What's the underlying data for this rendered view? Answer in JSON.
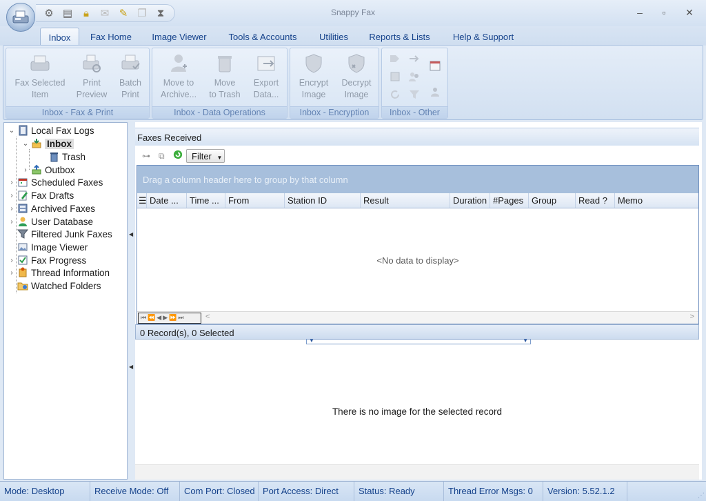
{
  "window": {
    "title": "Snappy Fax",
    "minimize": "–",
    "maximize": "▫",
    "close": "✕"
  },
  "quick_access_icons": [
    "gear-icon",
    "document-icon",
    "lock-icon",
    "fax-icon",
    "wand-icon",
    "copy-icon",
    "hourglass-icon"
  ],
  "tabs": [
    {
      "label": "Inbox",
      "active": true
    },
    {
      "label": "Fax Home"
    },
    {
      "label": "Image Viewer"
    },
    {
      "label": "Tools & Accounts"
    },
    {
      "label": "Utilities"
    },
    {
      "label": "Reports & Lists"
    },
    {
      "label": "Help & Support"
    }
  ],
  "ribbon": {
    "groups": [
      {
        "label": "Inbox - Fax & Print",
        "buttons": [
          {
            "line1": "Fax Selected",
            "line2": "Item"
          },
          {
            "line1": "Print",
            "line2": "Preview"
          },
          {
            "line1": "Batch",
            "line2": "Print"
          }
        ]
      },
      {
        "label": "Inbox - Data Operations",
        "buttons": [
          {
            "line1": "Move to",
            "line2": "Archive..."
          },
          {
            "line1": "Move",
            "line2": "to Trash"
          },
          {
            "line1": "Export",
            "line2": "Data..."
          }
        ]
      },
      {
        "label": "Inbox - Encryption",
        "buttons": [
          {
            "line1": "Encrypt",
            "line2": "Image"
          },
          {
            "line1": "Decrypt",
            "line2": "Image"
          }
        ]
      },
      {
        "label": "Inbox - Other"
      }
    ]
  },
  "tree": {
    "items": [
      {
        "label": "Local Fax Logs"
      },
      {
        "label": "Inbox",
        "selected": true
      },
      {
        "label": "Trash"
      },
      {
        "label": "Outbox"
      },
      {
        "label": "Scheduled Faxes"
      },
      {
        "label": "Fax Drafts"
      },
      {
        "label": "Archived Faxes"
      },
      {
        "label": "User Database"
      },
      {
        "label": "Filtered Junk Faxes"
      },
      {
        "label": "Image Viewer"
      },
      {
        "label": "Fax Progress"
      },
      {
        "label": "Thread Information"
      },
      {
        "label": "Watched Folders"
      }
    ]
  },
  "grid": {
    "panel_title": "Faxes Received",
    "filter_label": "Filter",
    "group_hint": "Drag a column header here to group by that column",
    "columns": [
      "Date ...",
      "Time ...",
      "From",
      "Station ID",
      "Result",
      "Duration",
      "#Pages",
      "Group",
      "Read ?",
      "Memo"
    ],
    "empty_text": "<No data to display>",
    "nav_buttons": "⏮⏪◀▶⏩⏭",
    "scroll_left": "<",
    "scroll_right": ">",
    "records": "0 Record(s), 0 Selected"
  },
  "image_pane": {
    "message": "There is no image for the selected record"
  },
  "statusbar": {
    "mode": "Mode: Desktop",
    "receive_mode": "Receive Mode: Off",
    "com_port": "Com Port: Closed",
    "port_access": "Port Access: Direct",
    "status": "Status: Ready",
    "thread_errors": "Thread Error Msgs: 0",
    "version": "Version: 5.52.1.2"
  },
  "colors": {
    "ribbon_text": "#15428b",
    "disabled_text": "#8f9aa8",
    "group_header": "#a7bfdc"
  }
}
